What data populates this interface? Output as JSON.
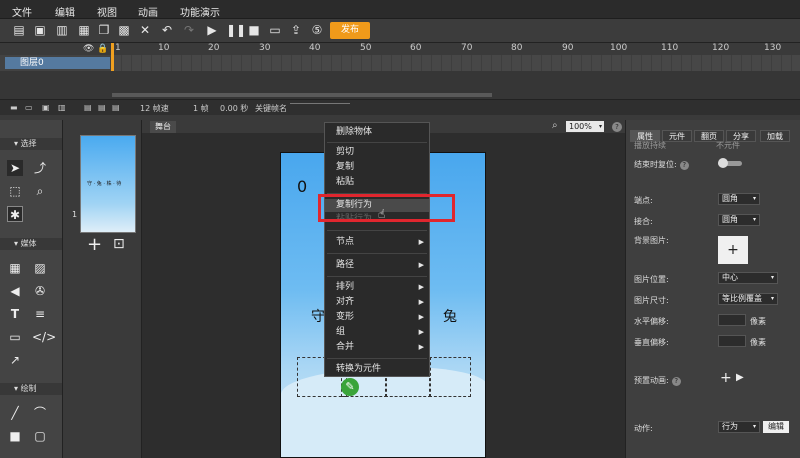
{
  "menu": [
    "文件",
    "编辑",
    "视图",
    "动画",
    "功能演示"
  ],
  "toolbar": {
    "publish_label": "发布",
    "icons": [
      "new-file-icon",
      "save-icon",
      "save-as-icon",
      "cut-icon",
      "copy-icon",
      "paste-icon",
      "delete-icon",
      "undo-icon",
      "redo-icon",
      "play-icon",
      "pause-icon",
      "stop-icon",
      "preview-icon",
      "share-icon",
      "html5-icon"
    ]
  },
  "timeline": {
    "ruler": [
      "1",
      "10",
      "20",
      "30",
      "40",
      "50",
      "60",
      "70",
      "80",
      "90",
      "100",
      "110",
      "120",
      "130"
    ],
    "layer_name": "图层0",
    "fps": "12 帧速",
    "frame": "1 帧",
    "time": "0.00 秒",
    "keyframe_label": "关键帧名"
  },
  "left_tools": {
    "select_section": "选择",
    "media_section": "媒体",
    "draw_section": "绘制"
  },
  "scenes": {
    "scene_number": "1",
    "thumb_text": "守 · 兔 · 株 · 待"
  },
  "stage": {
    "tab_label": "舞台",
    "zoom": "100%",
    "score": "0",
    "left_char": "守",
    "right_char": "兔"
  },
  "context_menu": {
    "items": [
      {
        "label": "删除物体",
        "submenu": false
      },
      {
        "label": "剪切",
        "submenu": false
      },
      {
        "label": "复制",
        "submenu": false
      },
      {
        "label": "粘贴",
        "submenu": false
      },
      {
        "label": "复制行为",
        "submenu": false,
        "highlighted": true
      },
      {
        "label": "粘贴行为",
        "submenu": false,
        "disabled": true
      },
      {
        "label": "节点",
        "submenu": true
      },
      {
        "label": "路径",
        "submenu": true
      },
      {
        "label": "排列",
        "submenu": true
      },
      {
        "label": "对齐",
        "submenu": true
      },
      {
        "label": "变形",
        "submenu": true
      },
      {
        "label": "组",
        "submenu": true
      },
      {
        "label": "合并",
        "submenu": true
      },
      {
        "label": "转换为元件",
        "submenu": false
      }
    ]
  },
  "right_panel": {
    "tabs": [
      "属性",
      "元件",
      "翻页",
      "分享",
      "加载"
    ],
    "top_row_label": "播放持续",
    "top_row_value": "不元件",
    "reset_label": "结束时复位:",
    "endpoint_label": "端点:",
    "endpoint_value": "圆角",
    "join_label": "接合:",
    "join_value": "圆角",
    "bg_image_label": "背景图片:",
    "img_pos_label": "图片位置:",
    "img_pos_value": "中心",
    "img_size_label": "图片尺寸:",
    "img_size_value": "等比例覆盖",
    "h_offset_label": "水平偏移:",
    "v_offset_label": "垂直偏移:",
    "unit": "像素",
    "preset_anim_label": "预置动画:",
    "action_label": "动作:",
    "action_value": "行为",
    "edit_label": "编辑"
  },
  "colors": {
    "publish": "#f09a1a",
    "highlight_box": "#e0262e",
    "layer_selected": "#557aa0",
    "canvas_sky": "#49a7ee"
  }
}
